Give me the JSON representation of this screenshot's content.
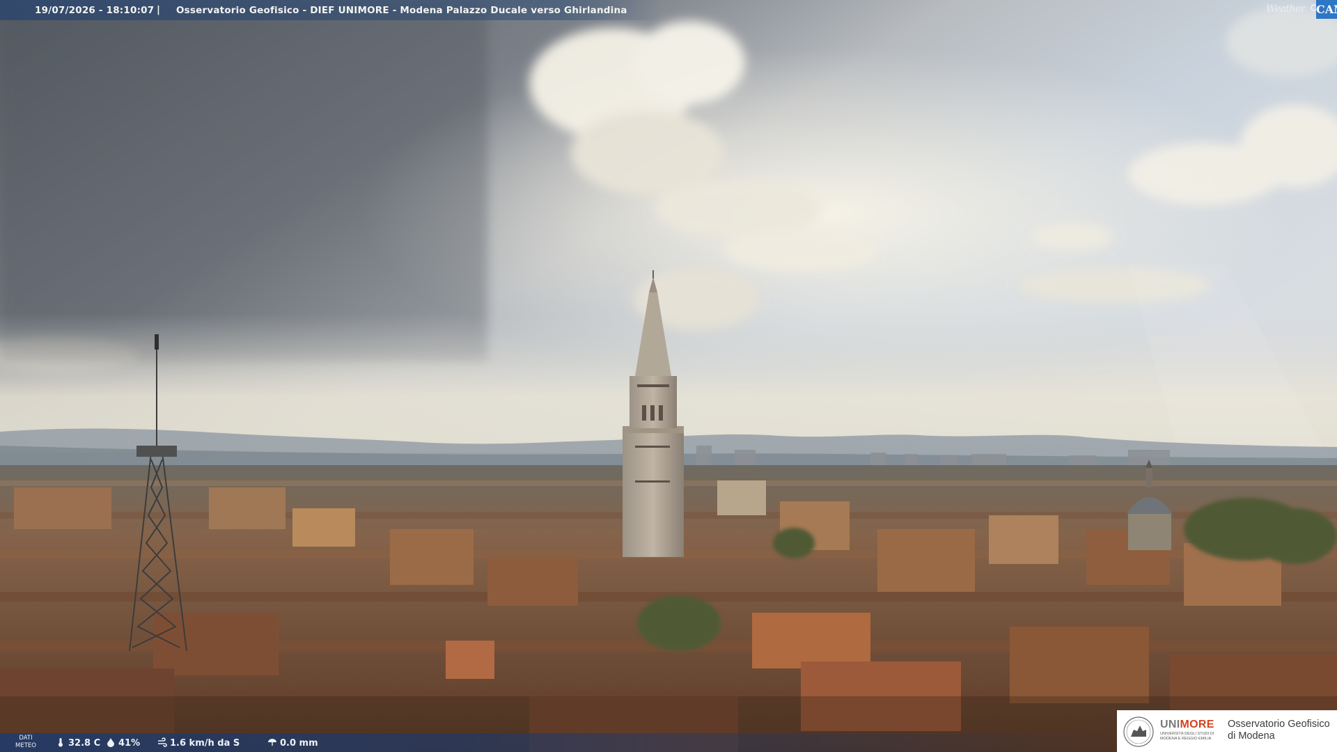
{
  "overlay": {
    "timestamp": "19/07/2026 - 18:10:07",
    "separator": "|",
    "title": "Osservatorio Geofisico - DIEF UNIMORE - Modena Palazzo Ducale verso Ghirlandina"
  },
  "weathercam_logo": {
    "text_left": "Weather",
    "text_right": "CAM"
  },
  "meteo": {
    "label_line1": "DATI",
    "label_line2": "METEO",
    "temperature": "32.8 C",
    "humidity": "41%",
    "wind": "1.6 km/h da S",
    "rain": "0.0 mm",
    "icons": [
      "thermometer-icon",
      "humidity-drop-icon",
      "wind-icon",
      "rain-icon"
    ]
  },
  "unimore_logo": {
    "uni": "UNI",
    "more": "MORE",
    "subtitle": "UNIVERSITÀ DEGLI STUDI DI MODENA E REGGIO EMILIA",
    "observatory_line1": "Osservatorio Geofisico",
    "observatory_line2": "di Modena"
  },
  "colors": {
    "caption_bar": "#2d466e",
    "meteo_bar": "#1c3a6e",
    "weathercam_blue": "#2e76c6",
    "unimore_red": "#d4411f",
    "sky_top_left": "#5e646b",
    "sky_bright": "#f2efe4",
    "roofs": "#8a5a3c"
  }
}
